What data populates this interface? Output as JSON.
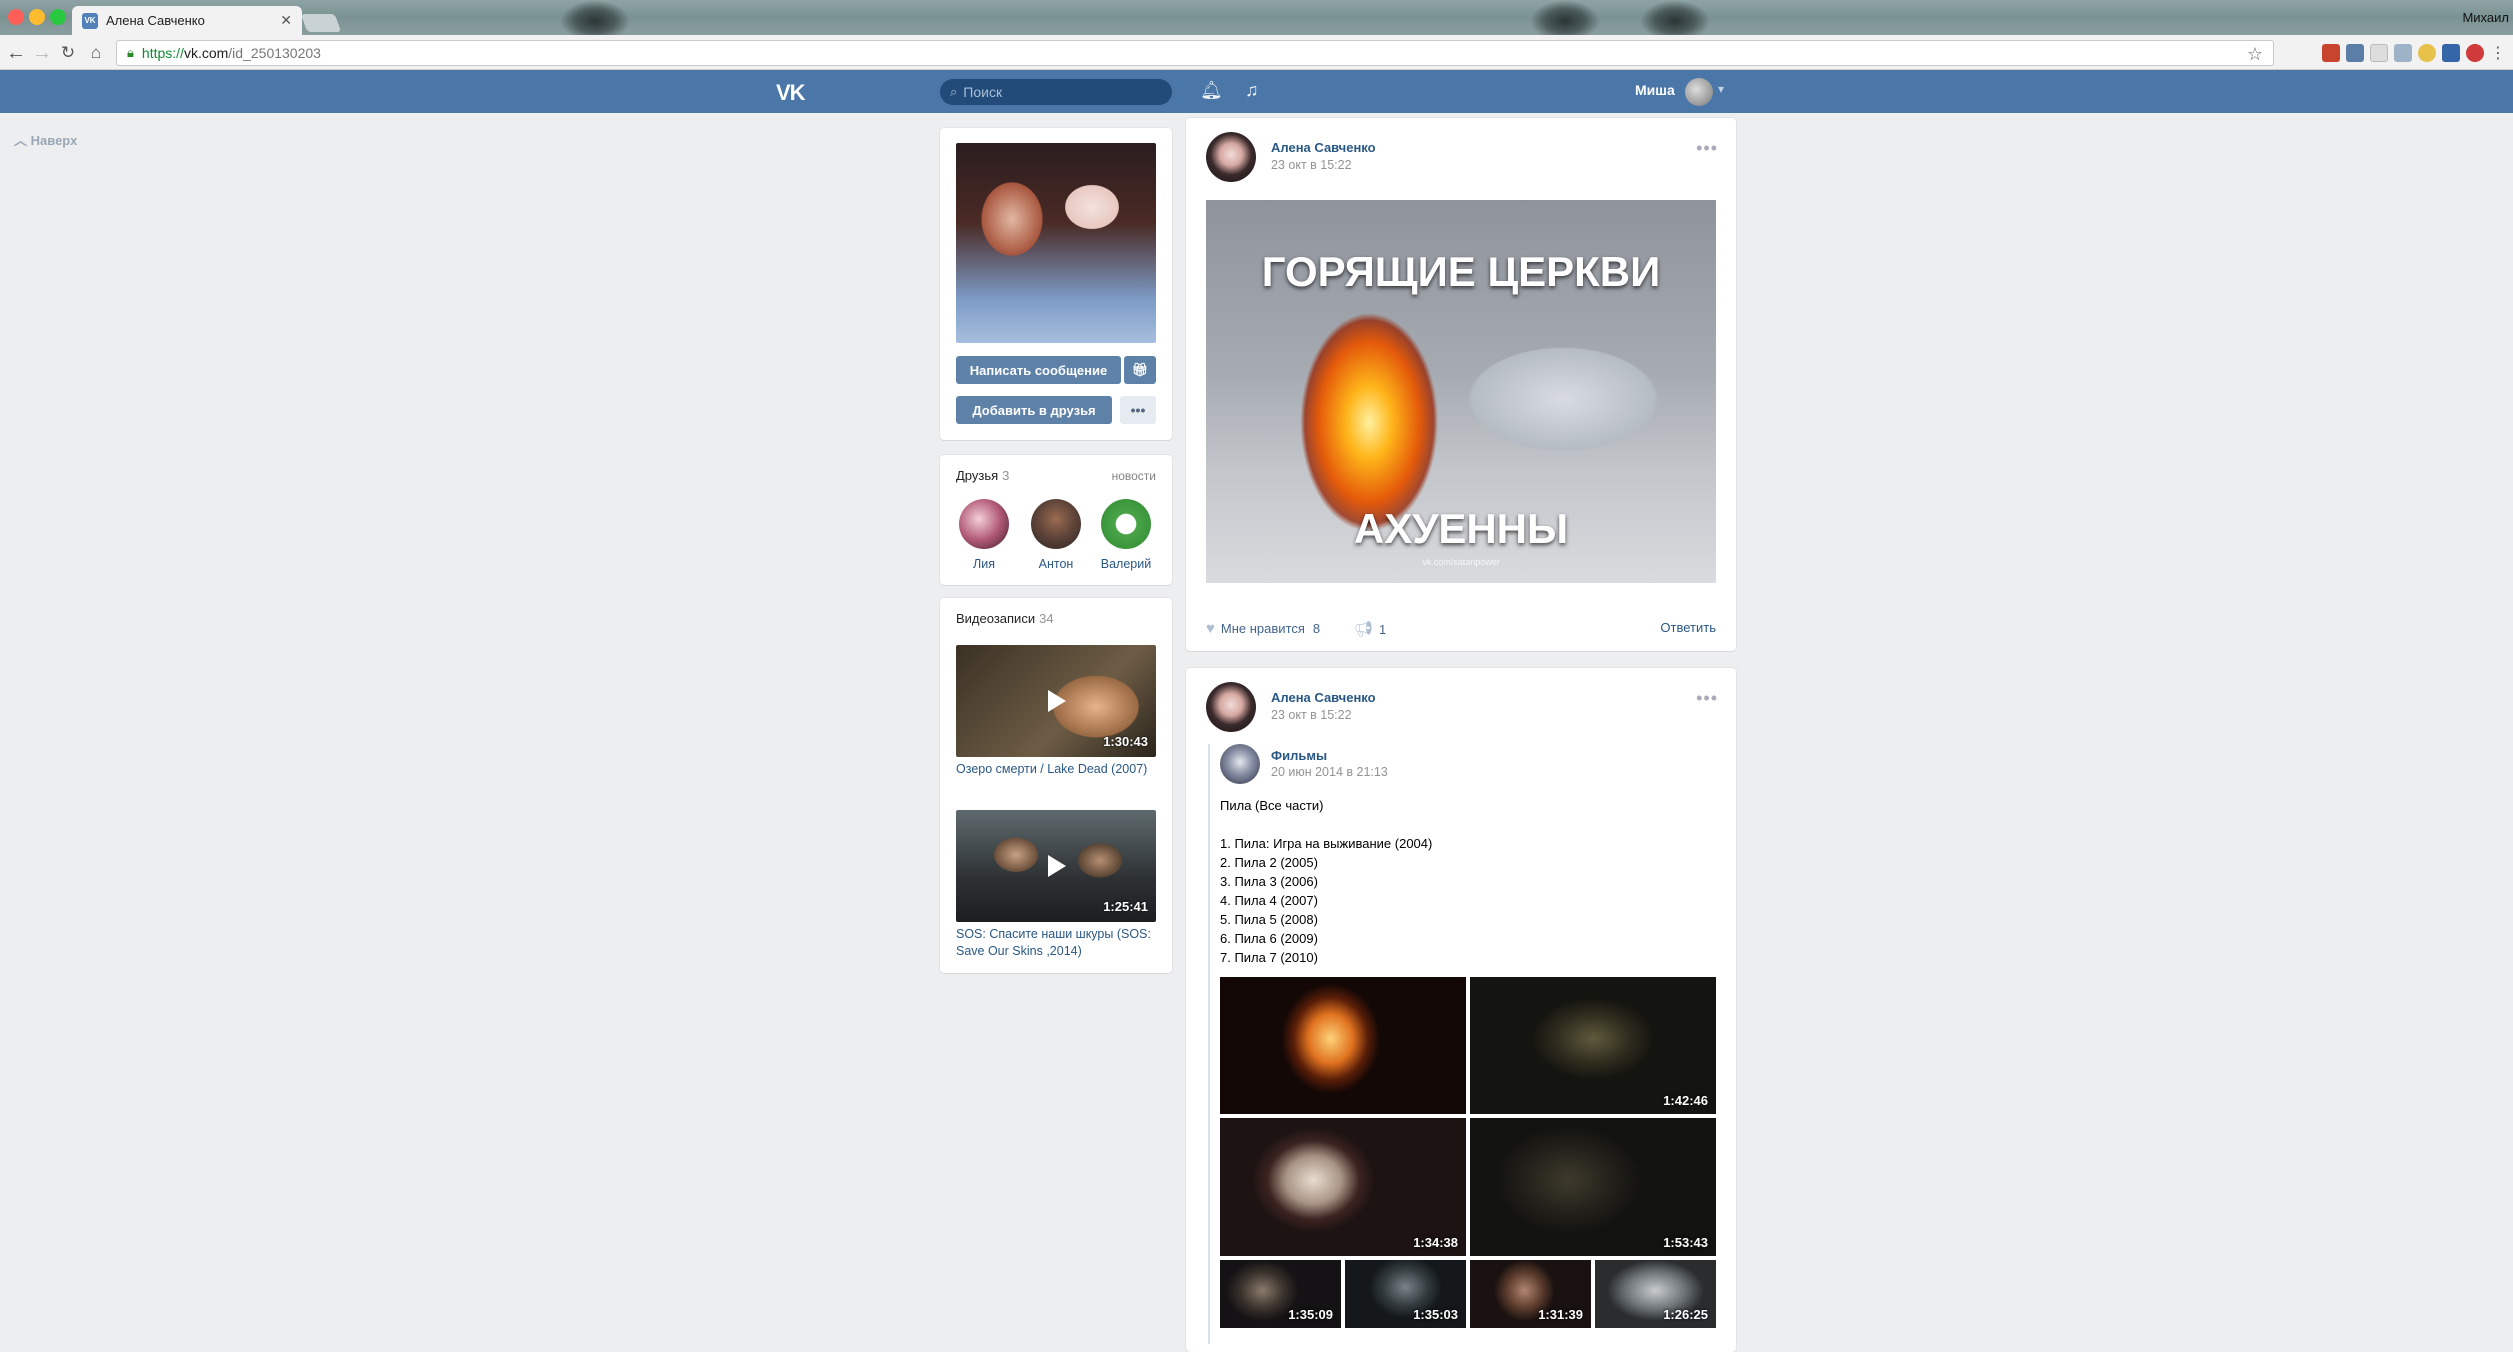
{
  "browser": {
    "tab_title": "Алена Савченко",
    "url_scheme": "https://",
    "url_host": "vk.com",
    "url_path": "/id_250130203",
    "corner_text": "Михаил"
  },
  "vk_header": {
    "logo": "VK",
    "search_placeholder": "Поиск",
    "user_name": "Миша"
  },
  "scroll_up": {
    "label": "Наверх"
  },
  "profile": {
    "message_button": "Написать сообщение",
    "add_friend_button": "Добавить в друзья",
    "more_glyph": "•••"
  },
  "friends": {
    "title": "Друзья",
    "count": "3",
    "news_link": "новости",
    "items": [
      {
        "name": "Лия"
      },
      {
        "name": "Антон"
      },
      {
        "name": "Валерий"
      }
    ]
  },
  "videos": {
    "title": "Видеозаписи",
    "count": "34",
    "items": [
      {
        "title": "Озеро смерти / Lake Dead (2007)",
        "duration": "1:30:43"
      },
      {
        "title": "SOS: Спасите наши шкуры (SOS: Save Our Skins ,2014)",
        "duration": "1:25:41"
      }
    ]
  },
  "posts": [
    {
      "author": "Алена Савченко",
      "date": "23 окт в 15:22",
      "image_caption_top": "ГОРЯЩИЕ ЦЕРКВИ",
      "image_caption_bottom": "АХУЕННЫ",
      "image_watermark": "vk.com/satanpower",
      "likes_label": "Мне нравится",
      "likes_count": "8",
      "reposts_count": "1",
      "reply_label": "Ответить"
    },
    {
      "author": "Алена Савченко",
      "date": "23 окт в 15:22",
      "repost": {
        "author": "Фильмы",
        "date": "20 июн 2014 в 21:13",
        "text_title": "Пила (Все части)",
        "list": [
          "1. Пила: Игра на выживание (2004)",
          "2. Пила 2 (2005)",
          "3. Пила 3 (2006)",
          "4. Пила 4 (2007)",
          "5. Пила 5 (2008)",
          "6. Пила 6 (2009)",
          "7. Пила 7 (2010)"
        ],
        "videos": [
          {
            "duration": ""
          },
          {
            "duration": "1:42:46"
          },
          {
            "duration": "1:34:38"
          },
          {
            "duration": "1:53:43"
          },
          {
            "duration": "1:35:09"
          },
          {
            "duration": "1:35:03"
          },
          {
            "duration": "1:31:39"
          },
          {
            "duration": "1:26:25"
          }
        ]
      }
    }
  ]
}
